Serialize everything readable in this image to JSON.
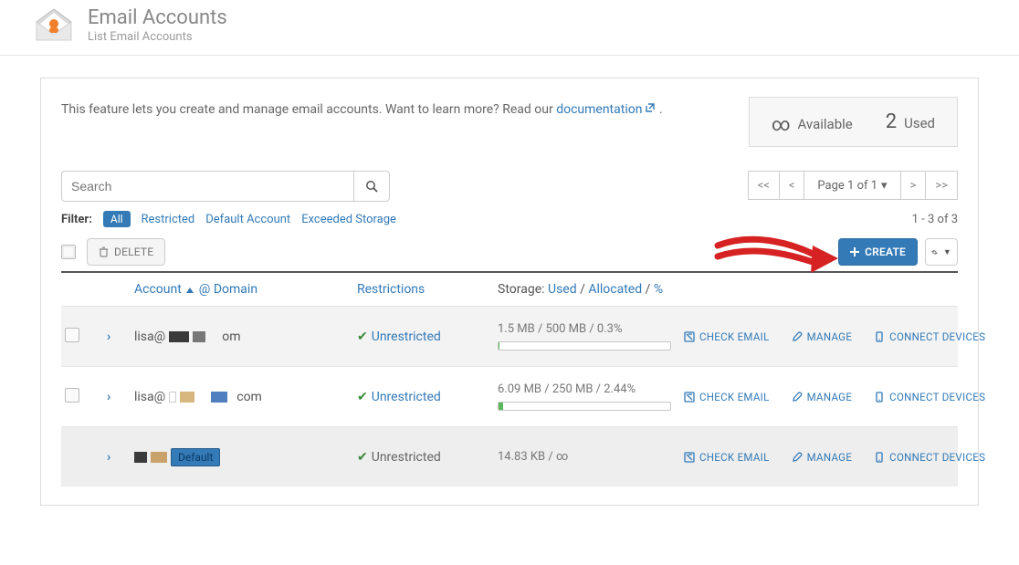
{
  "header": {
    "title": "Email Accounts",
    "subtitle": "List Email Accounts"
  },
  "intro": {
    "text_a": "This feature lets you create and manage email accounts. Want to learn more? Read our ",
    "doc_link": "documentation",
    "text_b": " ."
  },
  "stats": {
    "available_symbol": "∞",
    "available_label": "Available",
    "used_value": "2",
    "used_label": "Used"
  },
  "search": {
    "placeholder": "Search"
  },
  "pager": {
    "first": "<<",
    "prev": "<",
    "label": "Page 1 of 1",
    "next": ">",
    "last": ">>"
  },
  "filters": {
    "label": "Filter:",
    "all": "All",
    "items": [
      "Restricted",
      "Default Account",
      "Exceeded Storage"
    ]
  },
  "count_text": "1 - 3 of 3",
  "buttons": {
    "delete": "DELETE",
    "create": "CREATE"
  },
  "columns": {
    "account": "Account",
    "at": "@",
    "domain": "Domain",
    "restrictions": "Restrictions",
    "storage_prefix": "Storage:",
    "used": "Used",
    "allocated": "Allocated",
    "pct": "%"
  },
  "action_labels": {
    "check": "CHECK EMAIL",
    "manage": "MANAGE",
    "connect": "CONNECT DEVICES"
  },
  "default_badge": "Default",
  "rows": [
    {
      "account_prefix": "lisa@",
      "account_suffix": "om",
      "restriction": "Unrestricted",
      "restriction_link": true,
      "storage": "1.5 MB / 500 MB / 0.3%",
      "pct": 0.3,
      "show_checkbox": true,
      "show_bar": true
    },
    {
      "account_prefix": "lisa@",
      "account_suffix": "com",
      "restriction": "Unrestricted",
      "restriction_link": true,
      "storage": "6.09 MB / 250 MB / 2.44%",
      "pct": 2.44,
      "show_checkbox": true,
      "show_bar": true
    },
    {
      "account_prefix": "",
      "account_suffix": "",
      "restriction": "Unrestricted",
      "restriction_link": false,
      "storage": "14.83 KB / ∞",
      "pct": 0,
      "show_checkbox": false,
      "show_bar": false,
      "is_default": true
    }
  ]
}
